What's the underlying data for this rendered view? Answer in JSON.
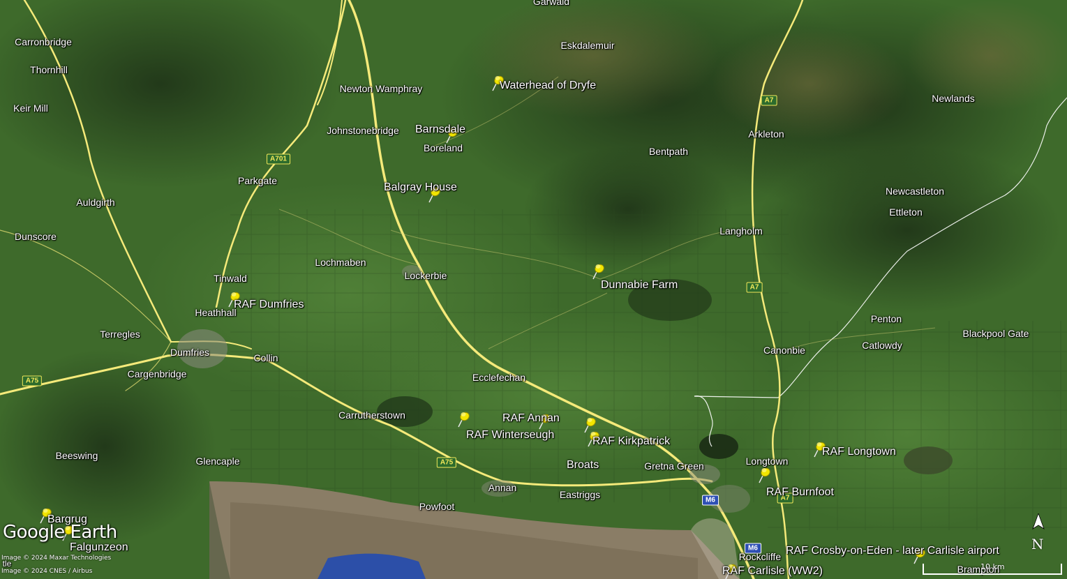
{
  "app": {
    "logo_text": "Google Earth",
    "credits": [
      "Image © 2024 Maxar Technologies",
      "Image © 2024 CNES / Airbus"
    ],
    "compass_letter": "N",
    "scale_label": "10 km",
    "cut_label": "tle"
  },
  "colors": {
    "land": "#3f6b2c",
    "land_dark": "#263f1c",
    "moor": "#5d6a32",
    "road": "#f5ea7a",
    "estuary": "#8a7d66",
    "water": "#2c4fa8",
    "border": "#ffffff"
  },
  "places": [
    {
      "id": "garwald",
      "label": "Garwald"
    },
    {
      "id": "carronbridge",
      "label": "Carronbridge"
    },
    {
      "id": "thornhill",
      "label": "Thornhill"
    },
    {
      "id": "keir-mill",
      "label": "Keir Mill"
    },
    {
      "id": "eskdalemuir",
      "label": "Eskdalemuir"
    },
    {
      "id": "newton-wamphray",
      "label": "Newton Wamphray"
    },
    {
      "id": "johnstonebridge",
      "label": "Johnstonebridge"
    },
    {
      "id": "boreland",
      "label": "Boreland"
    },
    {
      "id": "bentpath",
      "label": "Bentpath"
    },
    {
      "id": "arkleton",
      "label": "Arkleton"
    },
    {
      "id": "newlands",
      "label": "Newlands"
    },
    {
      "id": "parkgate",
      "label": "Parkgate"
    },
    {
      "id": "auldgirth",
      "label": "Auldgirth"
    },
    {
      "id": "newcastleton",
      "label": "Newcastleton"
    },
    {
      "id": "ettleton",
      "label": "Ettleton"
    },
    {
      "id": "langholm",
      "label": "Langholm"
    },
    {
      "id": "dunscore",
      "label": "Dunscore"
    },
    {
      "id": "lochmaben",
      "label": "Lochmaben"
    },
    {
      "id": "lockerbie",
      "label": "Lockerbie"
    },
    {
      "id": "tinwald",
      "label": "Tinwald"
    },
    {
      "id": "heathhall",
      "label": "Heathhall"
    },
    {
      "id": "terregles",
      "label": "Terregles"
    },
    {
      "id": "penton",
      "label": "Penton"
    },
    {
      "id": "blackpool-gate",
      "label": "Blackpool Gate"
    },
    {
      "id": "catlowdy",
      "label": "Catlowdy"
    },
    {
      "id": "canonbie",
      "label": "Canonbie"
    },
    {
      "id": "dumfries",
      "label": "Dumfries"
    },
    {
      "id": "collin",
      "label": "Collin"
    },
    {
      "id": "cargenbridge",
      "label": "Cargenbridge"
    },
    {
      "id": "ecclefechan",
      "label": "Ecclefechan"
    },
    {
      "id": "carrutherstown",
      "label": "Carrutherstown"
    },
    {
      "id": "beeswing",
      "label": "Beeswing"
    },
    {
      "id": "glencaple",
      "label": "Glencaple"
    },
    {
      "id": "longtown",
      "label": "Longtown"
    },
    {
      "id": "gretna-green",
      "label": "Gretna Green"
    },
    {
      "id": "annan",
      "label": "Annan"
    },
    {
      "id": "eastriggs",
      "label": "Eastriggs"
    },
    {
      "id": "powfoot",
      "label": "Powfoot"
    },
    {
      "id": "rockcliffe",
      "label": "Rockcliffe"
    },
    {
      "id": "brampton",
      "label": "Brampton"
    }
  ],
  "placemarks": [
    {
      "id": "waterhead-of-dryfe",
      "label": "Waterhead of Dryfe"
    },
    {
      "id": "barnsdale",
      "label": "Barnsdale"
    },
    {
      "id": "balgray-house",
      "label": "Balgray House"
    },
    {
      "id": "dunnabie-farm",
      "label": "Dunnabie Farm"
    },
    {
      "id": "raf-dumfries",
      "label": "RAF Dumfries"
    },
    {
      "id": "raf-winterseugh",
      "label": "RAF Winterseugh"
    },
    {
      "id": "raf-annan",
      "label": "RAF Annan"
    },
    {
      "id": "raf-kirkpatrick",
      "label": "RAF Kirkpatrick"
    },
    {
      "id": "broats",
      "label": "Broats"
    },
    {
      "id": "raf-longtown",
      "label": "RAF Longtown"
    },
    {
      "id": "raf-burnfoot",
      "label": "RAF Burnfoot"
    },
    {
      "id": "raf-crosby-on-eden",
      "label": "RAF Crosby-on-Eden - later Carlisle airport"
    },
    {
      "id": "raf-carlisle",
      "label": "RAF Carlisle (WW2)"
    },
    {
      "id": "bargrug",
      "label": "Bargrug"
    },
    {
      "id": "falgunzeon",
      "label": "Falgunzeon"
    }
  ],
  "road_shields": [
    {
      "id": "a701",
      "label": "A701",
      "kind": "a"
    },
    {
      "id": "a7-north",
      "label": "A7",
      "kind": "a"
    },
    {
      "id": "a7-mid",
      "label": "A7",
      "kind": "a"
    },
    {
      "id": "a7-south",
      "label": "A7",
      "kind": "a"
    },
    {
      "id": "a75-west",
      "label": "A75",
      "kind": "a"
    },
    {
      "id": "a75-east",
      "label": "A75",
      "kind": "a"
    },
    {
      "id": "m6-north",
      "label": "M6",
      "kind": "m"
    },
    {
      "id": "m6-south",
      "label": "M6",
      "kind": "m"
    }
  ]
}
